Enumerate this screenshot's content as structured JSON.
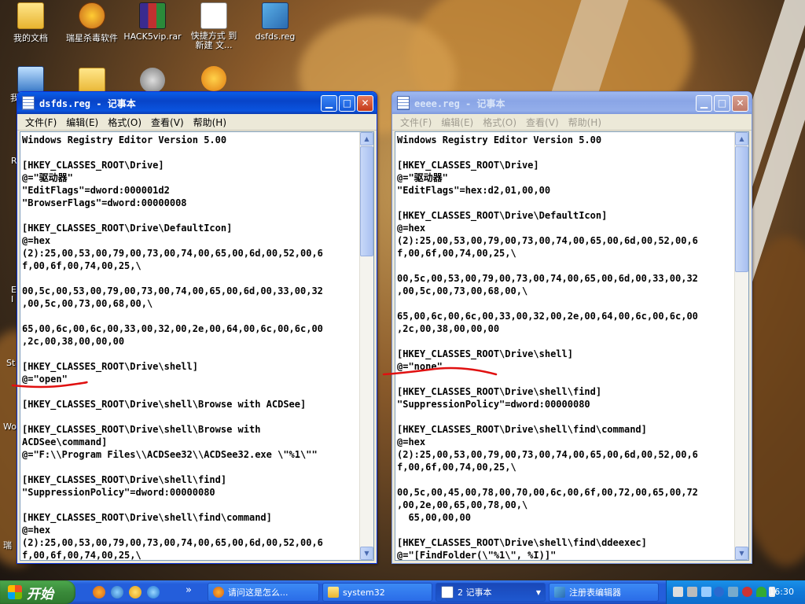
{
  "desktop": {
    "icons": [
      {
        "label": "我的文档"
      },
      {
        "label": "瑞星杀毒软件"
      },
      {
        "label": "HACK5vip.rar"
      },
      {
        "label": "快捷方式 到\n新建 文..."
      },
      {
        "label": "dsfds.reg"
      }
    ],
    "partial_labels": [
      "我",
      "R",
      "E",
      "I",
      "St",
      "Wo",
      "瑞"
    ]
  },
  "window_left": {
    "title": "dsfds.reg - 记事本",
    "menu": [
      "文件(F)",
      "编辑(E)",
      "格式(O)",
      "查看(V)",
      "帮助(H)"
    ],
    "content": "Windows Registry Editor Version 5.00\n\n[HKEY_CLASSES_ROOT\\Drive]\n@=\"驱动器\"\n\"EditFlags\"=dword:000001d2\n\"BrowserFlags\"=dword:00000008\n\n[HKEY_CLASSES_ROOT\\Drive\\DefaultIcon]\n@=hex\n(2):25,00,53,00,79,00,73,00,74,00,65,00,6d,00,52,00,6\nf,00,6f,00,74,00,25,\\\n\n00,5c,00,53,00,79,00,73,00,74,00,65,00,6d,00,33,00,32\n,00,5c,00,73,00,68,00,\\\n\n65,00,6c,00,6c,00,33,00,32,00,2e,00,64,00,6c,00,6c,00\n,2c,00,38,00,00,00\n\n[HKEY_CLASSES_ROOT\\Drive\\shell]\n@=\"open\"\n\n[HKEY_CLASSES_ROOT\\Drive\\shell\\Browse with ACDSee]\n\n[HKEY_CLASSES_ROOT\\Drive\\shell\\Browse with\nACDSee\\command]\n@=\"F:\\\\Program Files\\\\ACDSee32\\\\ACDSee32.exe \\\"%1\\\"\"\n\n[HKEY_CLASSES_ROOT\\Drive\\shell\\find]\n\"SuppressionPolicy\"=dword:00000080\n\n[HKEY_CLASSES_ROOT\\Drive\\shell\\find\\command]\n@=hex\n(2):25,00,53,00,79,00,73,00,74,00,65,00,6d,00,52,00,6\nf,00,6f,00,74,00,25,\\"
  },
  "window_right": {
    "title": "eeee.reg - 记事本",
    "menu": [
      "文件(F)",
      "编辑(E)",
      "格式(O)",
      "查看(V)",
      "帮助(H)"
    ],
    "content": "Windows Registry Editor Version 5.00\n\n[HKEY_CLASSES_ROOT\\Drive]\n@=\"驱动器\"\n\"EditFlags\"=hex:d2,01,00,00\n\n[HKEY_CLASSES_ROOT\\Drive\\DefaultIcon]\n@=hex\n(2):25,00,53,00,79,00,73,00,74,00,65,00,6d,00,52,00,6\nf,00,6f,00,74,00,25,\\\n\n00,5c,00,53,00,79,00,73,00,74,00,65,00,6d,00,33,00,32\n,00,5c,00,73,00,68,00,\\\n\n65,00,6c,00,6c,00,33,00,32,00,2e,00,64,00,6c,00,6c,00\n,2c,00,38,00,00,00\n\n[HKEY_CLASSES_ROOT\\Drive\\shell]\n@=\"none\"\n\n[HKEY_CLASSES_ROOT\\Drive\\shell\\find]\n\"SuppressionPolicy\"=dword:00000080\n\n[HKEY_CLASSES_ROOT\\Drive\\shell\\find\\command]\n@=hex\n(2):25,00,53,00,79,00,73,00,74,00,65,00,6d,00,52,00,6\nf,00,6f,00,74,00,25,\\\n\n00,5c,00,45,00,78,00,70,00,6c,00,6f,00,72,00,65,00,72\n,00,2e,00,65,00,78,00,\\\n  65,00,00,00\n\n[HKEY_CLASSES_ROOT\\Drive\\shell\\find\\ddeexec]\n@=\"[FindFolder(\\\"%1\\\", %I)]\""
  },
  "taskbar": {
    "start_label": "开始",
    "more_chevron": "»",
    "buttons": [
      {
        "label": "请问这是怎么..."
      },
      {
        "label": "system32"
      },
      {
        "label": "2 记事本"
      },
      {
        "label": "注册表编辑器"
      }
    ],
    "clock": "16:30"
  },
  "colors": {
    "annotation": "#e01010",
    "title_active": "#0a54df",
    "taskbar": "#245edb",
    "start": "#3a8a3a"
  }
}
